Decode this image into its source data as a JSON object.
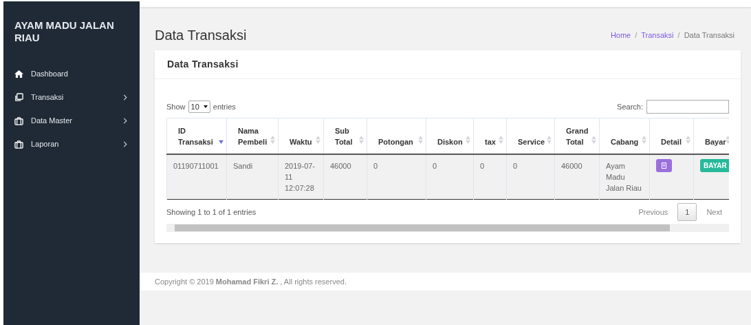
{
  "sidebar": {
    "brand": "AYAM MADU JALAN RIAU",
    "items": [
      {
        "label": "Dashboard",
        "kind": "home",
        "expandable": false
      },
      {
        "label": "Transaksi",
        "kind": "copy",
        "expandable": true
      },
      {
        "label": "Data Master",
        "kind": "briefcase",
        "expandable": true
      },
      {
        "label": "Laporan",
        "kind": "briefcase",
        "expandable": true
      }
    ]
  },
  "page": {
    "title": "Data Transaksi",
    "breadcrumb_separator": "/",
    "breadcrumb": [
      {
        "label": "Home",
        "link": true
      },
      {
        "label": "Transaksi",
        "link": true
      },
      {
        "label": "Data Transaksi",
        "link": false
      }
    ]
  },
  "card": {
    "title": "Data Transaksi",
    "length": {
      "before": "Show",
      "value": "10",
      "after": "entries"
    },
    "search": {
      "label": "Search:"
    },
    "table": {
      "columns": [
        {
          "label": "ID Transaksi",
          "sorted": true
        },
        {
          "label": "Nama Pembeli",
          "sorted": false
        },
        {
          "label": "Waktu",
          "sorted": false
        },
        {
          "label": "Sub Total",
          "sorted": false
        },
        {
          "label": "Potongan",
          "sorted": false
        },
        {
          "label": "Diskon",
          "sorted": false
        },
        {
          "label": "tax",
          "sorted": false
        },
        {
          "label": "Service",
          "sorted": false
        },
        {
          "label": "Grand Total",
          "sorted": false
        },
        {
          "label": "Cabang",
          "sorted": false
        },
        {
          "label": "Detail",
          "sorted": false
        },
        {
          "label": "Bayar",
          "sorted": false
        }
      ],
      "rows": [
        {
          "cells": [
            "01190711001",
            "Sandi",
            "2019-07-11 12:07:28",
            "46000",
            "0",
            "0",
            "0",
            "0",
            "46000",
            "Ayam Madu Jalan Riau"
          ],
          "pay_button": "BAYAR"
        }
      ]
    },
    "info": "Showing 1 to 1 of 1 entries",
    "pagination": [
      {
        "label": "Previous",
        "selected": false
      },
      {
        "label": "1",
        "selected": true
      },
      {
        "label": "Next",
        "selected": false
      }
    ]
  },
  "footer": {
    "text": "Copyright © 2019 **Mohamad Fikri Z.** , All rights reserved."
  }
}
